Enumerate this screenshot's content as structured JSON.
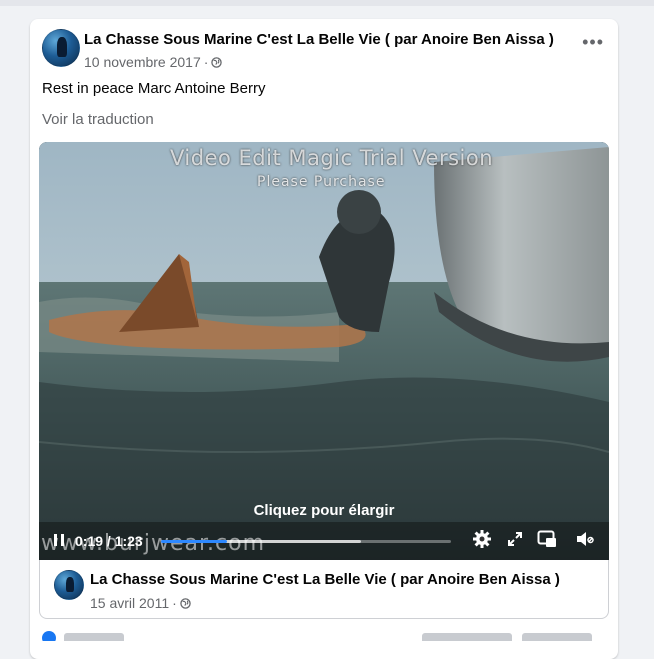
{
  "post": {
    "author": "La Chasse Sous Marine C'est La Belle Vie ( par Anoire Ben Aissa )",
    "date": "10 novembre 2017",
    "separator": "·",
    "text": "Rest in peace Marc Antoine Berry",
    "translate_label": "Voir la traduction",
    "more_icon": "more-options-icon",
    "privacy_icon": "globe-icon"
  },
  "video": {
    "watermark_title": "Video Edit Magic Trial Version",
    "watermark_sub": "Please Purchase",
    "watermark_site": "www.burjwear.com",
    "expand_label": "Cliquez pour élargir",
    "time_label": "0:19 / 1:23",
    "progress": 0.229,
    "buffered": 0.69,
    "accent": "#2d88ff",
    "icons": [
      "pause-icon",
      "settings-gear-icon",
      "fullscreen-icon",
      "picture-in-picture-icon",
      "volume-icon"
    ]
  },
  "shared": {
    "author": "La Chasse Sous Marine C'est La Belle Vie ( par Anoire Ben Aissa )",
    "date": "15 avril 2011",
    "separator": "·"
  }
}
